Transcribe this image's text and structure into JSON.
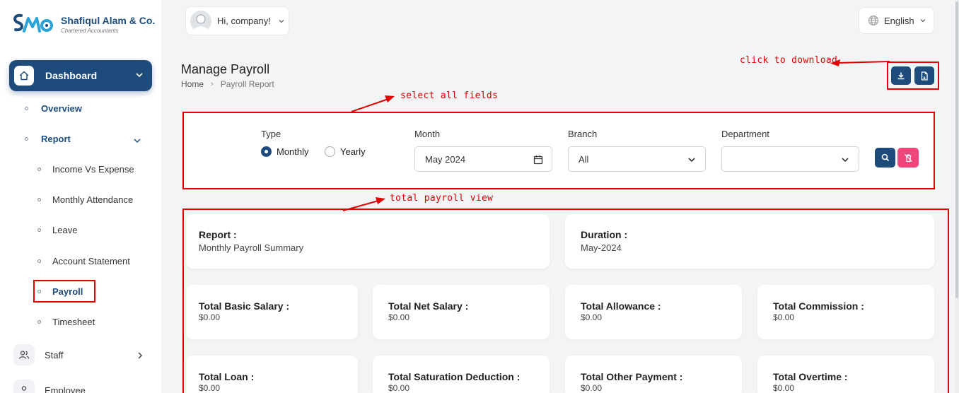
{
  "brand": {
    "name": "Shafiqul Alam & Co.",
    "tagline": "Chartered Accountants",
    "primary_color": "#1d4b7c"
  },
  "header": {
    "user_greeting": "Hi, company!",
    "language": "English"
  },
  "sidebar": {
    "dashboard": "Dashboard",
    "overview": "Overview",
    "report": "Report",
    "report_items": [
      "Income Vs Expense",
      "Monthly Attendance",
      "Leave",
      "Account Statement",
      "Payroll",
      "Timesheet"
    ],
    "staff": "Staff",
    "employee": "Employee"
  },
  "page": {
    "title": "Manage Payroll",
    "breadcrumb_home": "Home",
    "breadcrumb_current": "Payroll Report"
  },
  "annotations": {
    "download": "click to download",
    "select": "select all fields",
    "total": "total payroll view",
    "color": "#e00000"
  },
  "filters": {
    "type_label": "Type",
    "type_monthly": "Monthly",
    "type_yearly": "Yearly",
    "type_selected": "Monthly",
    "month_label": "Month",
    "month_value": "May 2024",
    "branch_label": "Branch",
    "branch_value": "All",
    "department_label": "Department",
    "department_value": ""
  },
  "summary": {
    "report_label": "Report :",
    "report_value": "Monthly Payroll Summary",
    "duration_label": "Duration :",
    "duration_value": "May-2024",
    "totals": [
      {
        "label": "Total Basic Salary :",
        "value": "$0.00"
      },
      {
        "label": "Total Net Salary :",
        "value": "$0.00"
      },
      {
        "label": "Total Allowance :",
        "value": "$0.00"
      },
      {
        "label": "Total Commission :",
        "value": "$0.00"
      },
      {
        "label": "Total Loan :",
        "value": "$0.00"
      },
      {
        "label": "Total Saturation Deduction :",
        "value": "$0.00"
      },
      {
        "label": "Total Other Payment :",
        "value": "$0.00"
      },
      {
        "label": "Total Overtime :",
        "value": "$0.00"
      }
    ]
  }
}
